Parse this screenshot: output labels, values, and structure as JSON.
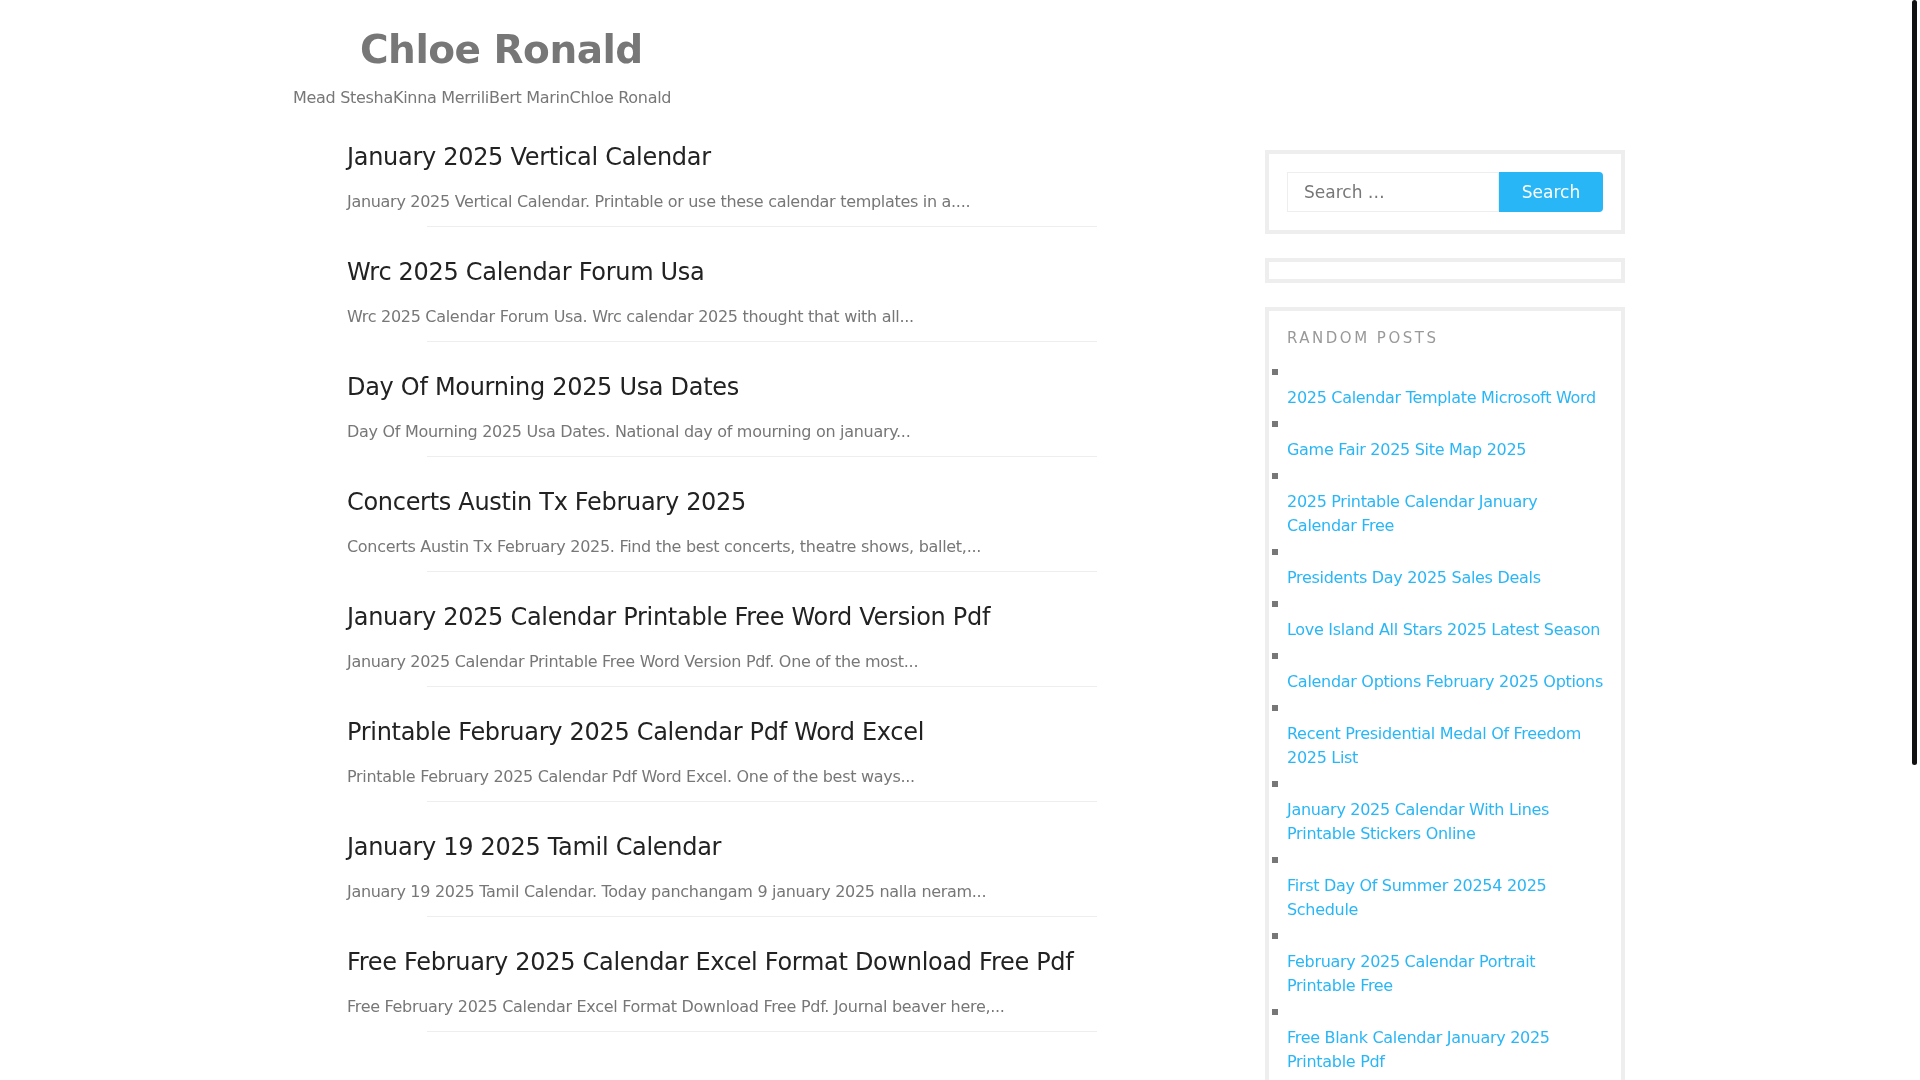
{
  "site": {
    "title": "Chloe Ronald",
    "description": "Mead SteshaKinna MerriliBert MarinChloe Ronald"
  },
  "posts": [
    {
      "title": "January 2025 Vertical Calendar",
      "excerpt": "January 2025 Vertical Calendar. Printable or use these calendar templates in a...."
    },
    {
      "title": "Wrc 2025 Calendar Forum Usa",
      "excerpt": "Wrc 2025 Calendar Forum Usa. Wrc calendar 2025 thought that with all..."
    },
    {
      "title": "Day Of Mourning 2025 Usa Dates",
      "excerpt": "Day Of Mourning 2025 Usa Dates. National day of mourning on january..."
    },
    {
      "title": "Concerts Austin Tx February 2025",
      "excerpt": "Concerts Austin Tx February 2025. Find the best concerts, theatre shows, ballet,..."
    },
    {
      "title": "January 2025 Calendar Printable Free Word Version Pdf",
      "excerpt": "January 2025 Calendar Printable Free Word Version Pdf. One of the most..."
    },
    {
      "title": "Printable February 2025 Calendar Pdf Word Excel",
      "excerpt": "Printable February 2025 Calendar Pdf Word Excel. One of the best ways..."
    },
    {
      "title": "January 19 2025 Tamil Calendar",
      "excerpt": "January 19 2025 Tamil Calendar. Today panchangam 9 january 2025 nalla neram..."
    },
    {
      "title": "Free February 2025 Calendar Excel Format Download Free Pdf",
      "excerpt": "Free February 2025 Calendar Excel Format Download Free Pdf. Journal beaver here,..."
    }
  ],
  "search": {
    "placeholder": "Search …",
    "button": "Search"
  },
  "random_posts": {
    "heading": "RANDOM POSTS",
    "items": [
      "2025 Calendar Template Microsoft Word",
      "Game Fair 2025 Site Map 2025",
      "2025 Printable Calendar January Calendar Free",
      "Presidents Day 2025 Sales Deals",
      "Love Island All Stars 2025 Latest Season",
      "Calendar Options February 2025 Options",
      "Recent Presidential Medal Of Freedom 2025 List",
      "January 2025 Calendar With Lines Printable Stickers Online",
      "First Day Of Summer 20254 2025 Schedule",
      "February 2025 Calendar Portrait Printable Free",
      "Free Blank Calendar January 2025 Printable Pdf"
    ]
  }
}
